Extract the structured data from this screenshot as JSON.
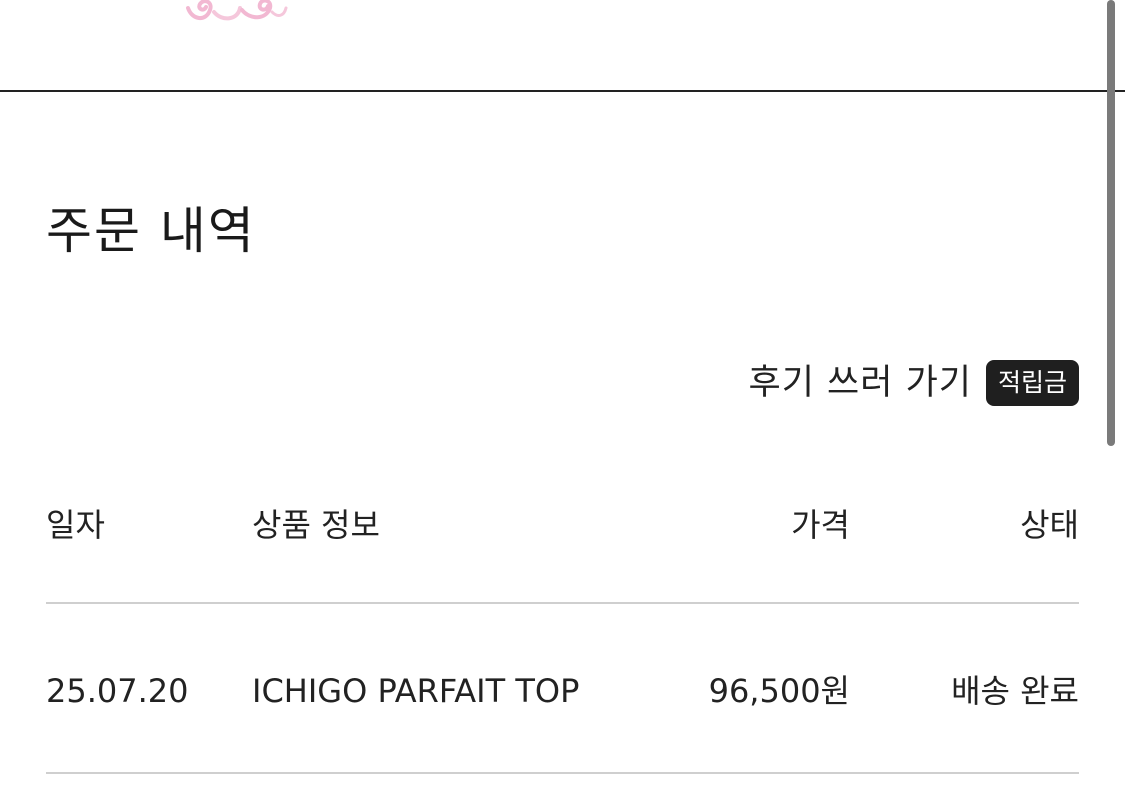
{
  "page": {
    "title": "주문 내역"
  },
  "actions": {
    "review_label": "후기 쓰러 가기",
    "points_badge": "적립금"
  },
  "table": {
    "headers": {
      "date": "일자",
      "product": "상품 정보",
      "price": "가격",
      "status": "상태"
    },
    "rows": [
      {
        "date": "25.07.20",
        "product": "ICHIGO PARFAIT TOP",
        "price": "96,500원",
        "status": "배송 완료"
      }
    ]
  },
  "colors": {
    "text": "#1a1a1a",
    "badge_bg": "#1f1f1f",
    "divider": "#cfcfcf",
    "header_line": "#222222",
    "logo_pink": "#f2b8d2"
  },
  "icons": {
    "logo": "pink-ornament-logo"
  }
}
